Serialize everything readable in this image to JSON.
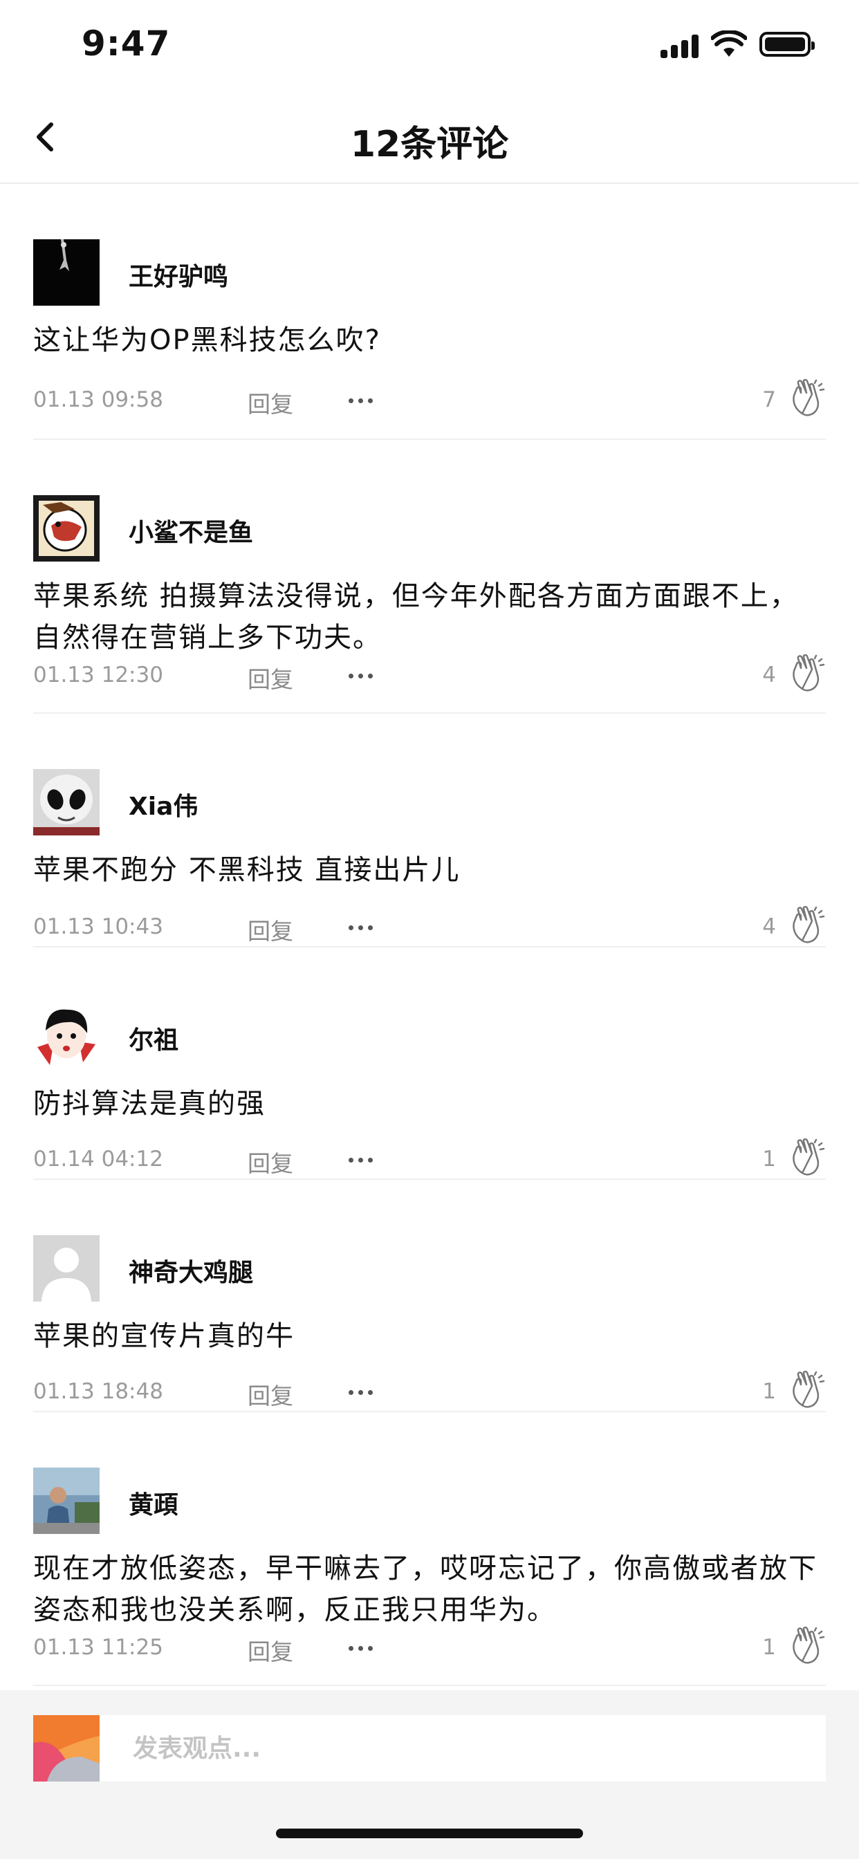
{
  "status_bar": {
    "time": "9:47"
  },
  "header": {
    "title": "12条评论"
  },
  "comments": [
    {
      "username": "王好驴鸣",
      "text": "这让华为OP黑科技怎么吹?",
      "time": "01.13 09:58",
      "reply_label": "回复",
      "likes": "7"
    },
    {
      "username": "小鲨不是鱼",
      "text": "苹果系统  拍摄算法没得说，但今年外配各方面方面跟不上，自然得在营销上多下功夫。",
      "time": "01.13 12:30",
      "reply_label": "回复",
      "likes": "4"
    },
    {
      "username": "Xia伟",
      "text": "苹果不跑分 不黑科技 直接出片儿",
      "time": "01.13 10:43",
      "reply_label": "回复",
      "likes": "4"
    },
    {
      "username": "尔祖",
      "text": "防抖算法是真的强",
      "time": "01.14 04:12",
      "reply_label": "回复",
      "likes": "1"
    },
    {
      "username": "神奇大鸡腿",
      "text": "苹果的宣传片真的牛",
      "time": "01.13 18:48",
      "reply_label": "回复",
      "likes": "1"
    },
    {
      "username": "黄頙",
      "text": "现在才放低姿态，早干嘛去了，哎呀忘记了，你高傲或者放下姿态和我也没关系啊，反正我只用华为。",
      "time": "01.13 11:25",
      "reply_label": "回复",
      "likes": "1"
    }
  ],
  "compose": {
    "placeholder": "发表观点..."
  },
  "icons": {
    "back": "chevron-left-icon",
    "more": "more-dots-icon",
    "like": "clap-hands-icon"
  },
  "colors": {
    "text_primary": "#111111",
    "text_secondary": "#9b9b9b",
    "divider": "#efefef",
    "bottom_bar": "#f4f4f4"
  }
}
